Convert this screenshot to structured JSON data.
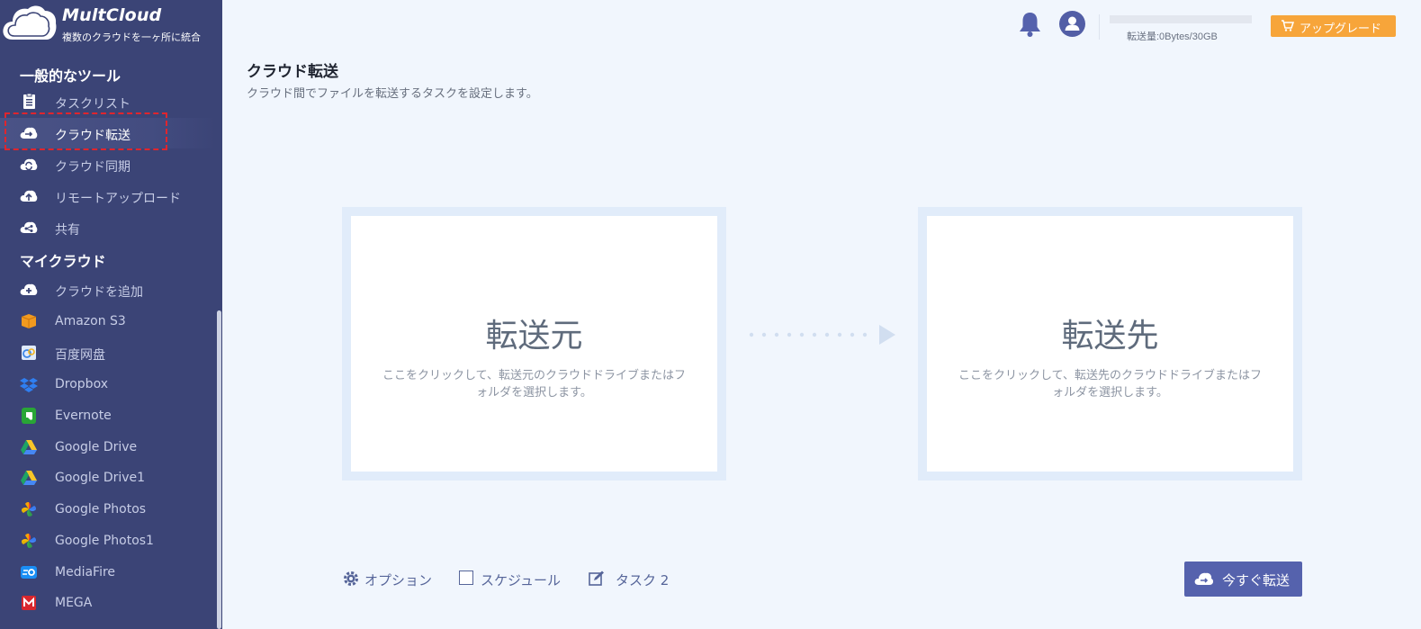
{
  "brand": {
    "name": "MultCloud",
    "tagline": "複数のクラウドを一ヶ所に統合"
  },
  "sidebar": {
    "section_tools": "一般的なツール",
    "tools": [
      {
        "label": "タスクリスト",
        "icon": "task-list-icon"
      },
      {
        "label": "クラウド転送",
        "icon": "cloud-transfer-icon",
        "active": true
      },
      {
        "label": "クラウド同期",
        "icon": "cloud-sync-icon"
      },
      {
        "label": "リモートアップロード",
        "icon": "remote-upload-icon"
      },
      {
        "label": "共有",
        "icon": "share-icon"
      }
    ],
    "section_clouds": "マイクラウド",
    "clouds": [
      {
        "label": "クラウドを追加",
        "icon": "add-cloud-icon"
      },
      {
        "label": "Amazon S3",
        "icon": "amazon-s3-icon"
      },
      {
        "label": "百度网盘",
        "icon": "baidu-icon"
      },
      {
        "label": "Dropbox",
        "icon": "dropbox-icon"
      },
      {
        "label": "Evernote",
        "icon": "evernote-icon"
      },
      {
        "label": "Google Drive",
        "icon": "google-drive-icon"
      },
      {
        "label": "Google Drive1",
        "icon": "google-drive-icon"
      },
      {
        "label": "Google Photos",
        "icon": "google-photos-icon"
      },
      {
        "label": "Google Photos1",
        "icon": "google-photos-icon"
      },
      {
        "label": "MediaFire",
        "icon": "mediafire-icon"
      },
      {
        "label": "MEGA",
        "icon": "mega-icon"
      }
    ]
  },
  "header": {
    "traffic_label": "転送量:0Bytes/30GB",
    "traffic_used_fraction": 0,
    "upgrade_label": "アップグレード"
  },
  "main": {
    "title": "クラウド転送",
    "subtitle": "クラウド間でファイルを転送するタスクを設定します。",
    "source": {
      "title": "転送元",
      "desc": "ここをクリックして、転送元のクラウドドライブまたはフォルダを選択します。"
    },
    "target": {
      "title": "転送先",
      "desc": "ここをクリックして、転送先のクラウドドライブまたはフォルダを選択します。"
    }
  },
  "bottom": {
    "options_label": "オプション",
    "schedule_label": "スケジュール",
    "task_label": "タスク 2",
    "transfer_label": "今すぐ転送"
  },
  "colors": {
    "sidebar": "#3b4476",
    "accent": "#5562ad",
    "upgrade": "#f7a53a",
    "background": "#f1f6fd"
  }
}
